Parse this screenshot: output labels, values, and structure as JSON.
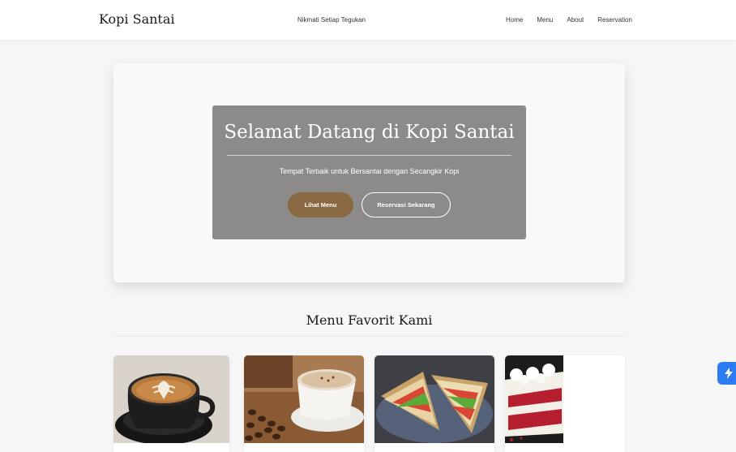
{
  "header": {
    "brand": "Kopi Santai",
    "tagline": "Nikmati Setiap Tegukan",
    "nav": [
      "Home",
      "Menu",
      "About",
      "Reservation"
    ]
  },
  "hero": {
    "title": "Selamat Datang di Kopi Santai",
    "subtitle": "Tempat Terbaik untuk Bersantai dengan Secangkir Kopi",
    "primary_button": "Lihat Menu",
    "secondary_button": "Reservasi Sekarang"
  },
  "menu_section": {
    "title": "Menu Favorit Kami",
    "items": [
      {
        "image": "latte-art-coffee"
      },
      {
        "image": "cappuccino-with-beans"
      },
      {
        "image": "club-sandwich"
      },
      {
        "image": "red-velvet-cake"
      }
    ]
  },
  "colors": {
    "accent": "#8a6a42",
    "overlay": "#8c8b8a",
    "floating_button": "#2b7bf2"
  }
}
